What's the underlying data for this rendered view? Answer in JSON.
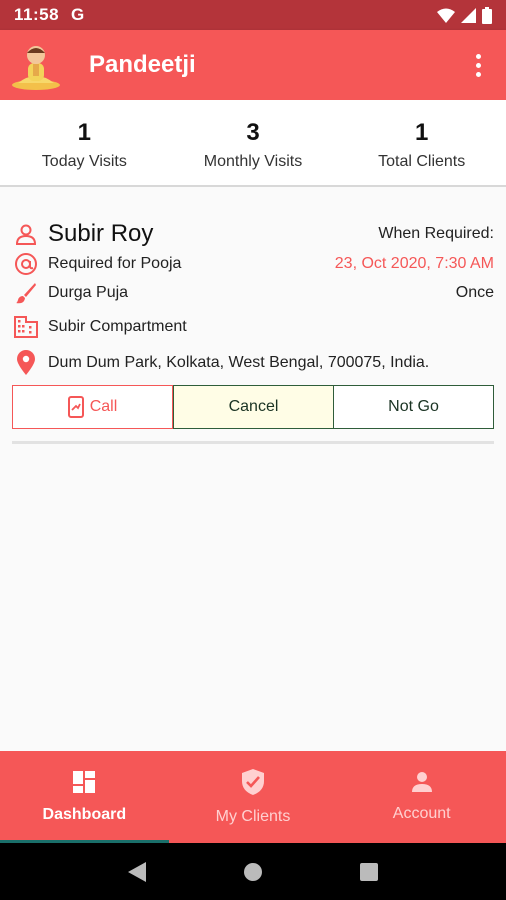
{
  "status_bar": {
    "time": "11:58",
    "g_label": "G"
  },
  "app_bar": {
    "title": "Pandeetji"
  },
  "stats": [
    {
      "value": "1",
      "label": "Today Visits"
    },
    {
      "value": "3",
      "label": "Monthly Visits"
    },
    {
      "value": "1",
      "label": "Total Clients"
    }
  ],
  "card": {
    "name": "Subir Roy",
    "when_label": "When Required:",
    "purpose": "Required for Pooja",
    "datetime": "23, Oct 2020, 7:30 AM",
    "pooja": "Durga Puja",
    "frequency": "Once",
    "building": "Subir Compartment",
    "address": "Dum Dum Park, Kolkata, West Bengal, 700075, India."
  },
  "actions": {
    "call": "Call",
    "cancel": "Cancel",
    "not_go": "Not Go"
  },
  "bottom_nav": [
    {
      "label": "Dashboard",
      "icon": "dashboard-icon",
      "active": true
    },
    {
      "label": "My Clients",
      "icon": "shield-check-icon",
      "active": false
    },
    {
      "label": "Account",
      "icon": "person-icon",
      "active": false
    }
  ],
  "colors": {
    "primary": "#f55757",
    "status_bar": "#b4343a",
    "accent": "#1a6f6a"
  }
}
